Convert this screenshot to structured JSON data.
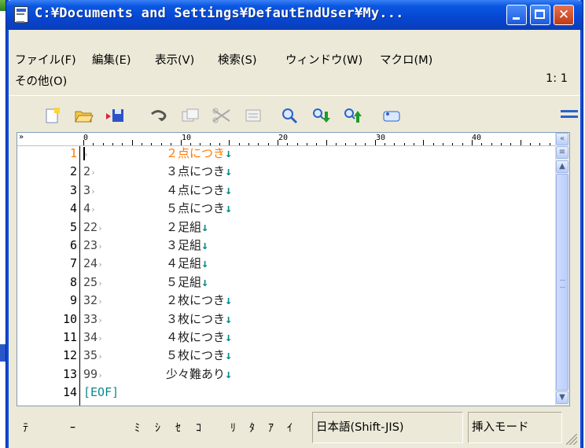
{
  "window": {
    "title": "C:¥Documents and Settings¥DefautEndUser¥My..."
  },
  "menu": {
    "row1": [
      "ファイル(F)",
      "編集(E)",
      "表示(V)",
      "検索(S)",
      "ウィンドウ(W)",
      "マクロ(M)"
    ],
    "row2": [
      "その他(O)"
    ],
    "position": "1: 1"
  },
  "toolbar": {
    "icons": [
      "new-file-icon",
      "open-folder-icon",
      "save-icon",
      "undo-icon",
      "copy-icon",
      "cut-icon",
      "paste-icon",
      "search-icon",
      "search-down-icon",
      "search-up-icon",
      "grep-icon",
      "menu-icon"
    ]
  },
  "ruler": {
    "labels": [
      "0",
      "10",
      "20",
      "30",
      "40"
    ],
    "left_marker": "»",
    "right_marker": "«"
  },
  "editor": {
    "lines": [
      {
        "num": "1",
        "code": "",
        "text": "２点につき",
        "eol": "↓",
        "current": true
      },
      {
        "num": "2",
        "code": "2",
        "text": "３点につき",
        "eol": "↓"
      },
      {
        "num": "3",
        "code": "3",
        "text": "４点につき",
        "eol": "↓"
      },
      {
        "num": "4",
        "code": "4",
        "text": "５点につき",
        "eol": "↓"
      },
      {
        "num": "5",
        "code": "22",
        "text": "２足組",
        "eol": "↓"
      },
      {
        "num": "6",
        "code": "23",
        "text": "３足組",
        "eol": "↓"
      },
      {
        "num": "7",
        "code": "24",
        "text": "４足組",
        "eol": "↓"
      },
      {
        "num": "8",
        "code": "25",
        "text": "５足組",
        "eol": "↓"
      },
      {
        "num": "9",
        "code": "32",
        "text": "２枚につき",
        "eol": "↓"
      },
      {
        "num": "10",
        "code": "33",
        "text": "３枚につき",
        "eol": "↓"
      },
      {
        "num": "11",
        "code": "34",
        "text": "４枚につき",
        "eol": "↓"
      },
      {
        "num": "12",
        "code": "35",
        "text": "５枚につき",
        "eol": "↓"
      },
      {
        "num": "13",
        "code": "99",
        "text": "少々難あり",
        "eol": "↓"
      },
      {
        "num": "14",
        "code": "[EOF]",
        "text": "",
        "eol": ""
      }
    ],
    "tab_mark": "›"
  },
  "status": {
    "glyphs": [
      "ﾃ",
      "ｰ",
      "ﾐ",
      "ｼ",
      "ｾ",
      "ｺ",
      "ﾘ",
      "ﾀ",
      "ｱ",
      "ｲ"
    ],
    "encoding": "日本語(Shift-JIS)",
    "mode": "挿入モード"
  },
  "colors": {
    "title_bar": "#0b57e1",
    "current_line": "#ff7a00",
    "eol_mark": "#0a8a8a"
  }
}
